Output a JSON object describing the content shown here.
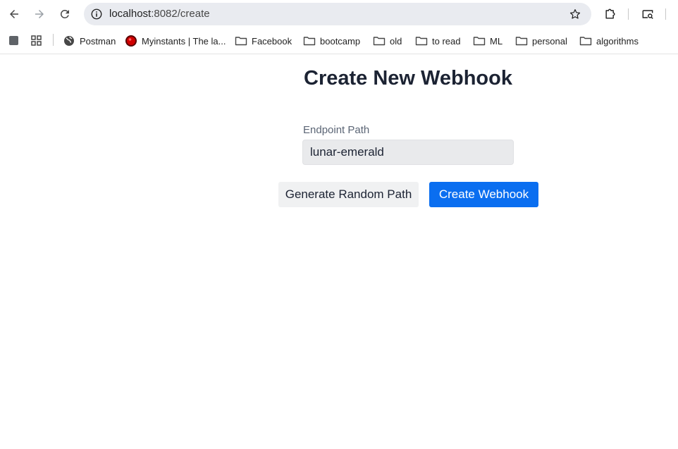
{
  "browser": {
    "url_host": "localhost",
    "url_path": ":8082/create",
    "bookmarks": [
      {
        "label": "Postman",
        "icon": "globe-icon"
      },
      {
        "label": "Myinstants | The la...",
        "icon": "myinstants-favicon"
      },
      {
        "label": "Facebook",
        "icon": "folder-icon"
      },
      {
        "label": "bootcamp",
        "icon": "folder-icon"
      },
      {
        "label": "old",
        "icon": "folder-icon"
      },
      {
        "label": "to read",
        "icon": "folder-icon"
      },
      {
        "label": "ML",
        "icon": "folder-icon"
      },
      {
        "label": "personal",
        "icon": "folder-icon"
      },
      {
        "label": "algorithms",
        "icon": "folder-icon"
      }
    ]
  },
  "page": {
    "title": "Create New Webhook",
    "endpoint_label": "Endpoint Path",
    "endpoint_value": "lunar-emerald",
    "generate_button": "Generate Random Path",
    "create_button": "Create Webhook"
  },
  "colors": {
    "primary": "#0a6ef0",
    "title_text": "#1c2333",
    "input_bg": "#e9eaec"
  }
}
